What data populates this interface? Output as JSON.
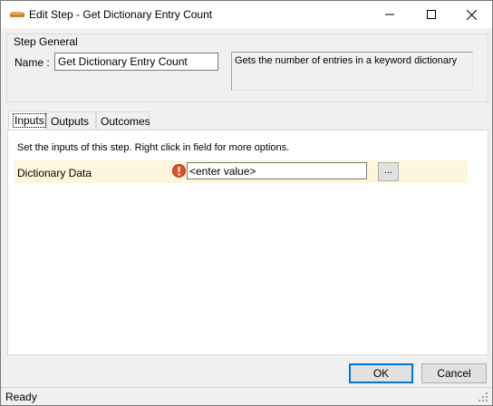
{
  "window": {
    "title": "Edit Step - Get Dictionary Entry Count",
    "app_icon": "step-icon",
    "controls": {
      "minimize": "minimize-icon",
      "maximize": "maximize-icon",
      "close": "close-icon"
    }
  },
  "step_general": {
    "legend": "Step General",
    "name_label": "Name :",
    "name_value": "Get Dictionary Entry Count",
    "description": "Gets the number of entries in a keyword dictionary"
  },
  "tabs": [
    {
      "label": "Inputs",
      "active": true
    },
    {
      "label": "Outputs",
      "active": false
    },
    {
      "label": "Outcomes",
      "active": false
    }
  ],
  "inputs_panel": {
    "instructions": "Set the inputs of this step.  Right click in field for more options.",
    "parameters": [
      {
        "label": "Dictionary Data",
        "value": "<enter value>",
        "status_icon": "error-icon",
        "browse_label": "..."
      }
    ]
  },
  "buttons": {
    "ok": "OK",
    "cancel": "Cancel"
  },
  "status": {
    "text": "Ready"
  },
  "colors": {
    "param_row_bg": "#fcf7dc",
    "ok_border": "#0078d7",
    "error_icon": "#e2502a"
  }
}
